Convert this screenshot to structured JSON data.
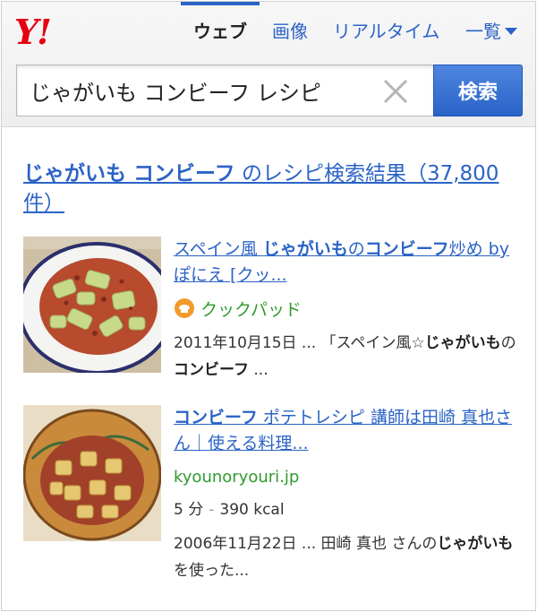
{
  "header": {
    "logo": "Y!",
    "tabs": [
      {
        "label": "ウェブ",
        "active": true
      },
      {
        "label": "画像",
        "active": false
      },
      {
        "label": "リアルタイム",
        "active": false
      },
      {
        "label": "一覧",
        "active": false
      }
    ],
    "search": {
      "value": "じゃがいも コンビーフ レシピ",
      "button_label": "検索"
    }
  },
  "results": {
    "heading": {
      "bold_part": "じゃがいも コンビーフ",
      "rest": " のレシピ検索結果（37,800件）"
    },
    "items": [
      {
        "title_parts": [
          {
            "text": "スペイン風 ",
            "bold": false
          },
          {
            "text": "じゃがいも",
            "bold": true
          },
          {
            "text": "の",
            "bold": false
          },
          {
            "text": "コンビーフ",
            "bold": true
          },
          {
            "text": "炒め by ぽにえ [クッ...",
            "bold": false
          }
        ],
        "source_name": "クックパッド",
        "snippet_parts": [
          {
            "text": "2011年10月15日 ... 「スペイン風☆",
            "bold": false
          },
          {
            "text": "じゃがいも",
            "bold": true
          },
          {
            "text": "の",
            "bold": false
          },
          {
            "text": "コンビーフ",
            "bold": true
          },
          {
            "text": " ...",
            "bold": false
          }
        ]
      },
      {
        "title_parts": [
          {
            "text": "コンビーフ",
            "bold": true
          },
          {
            "text": " ポテトレシピ 講師は田崎 真也さん｜使える料理...",
            "bold": false
          }
        ],
        "url": "kyounoryouri.jp",
        "meta_time": "5 分",
        "meta_sep": "-",
        "meta_kcal": "390 kcal",
        "snippet_parts": [
          {
            "text": "2006年11月22日 ... 田崎 真也 さんの",
            "bold": false
          },
          {
            "text": "じゃがいも",
            "bold": true
          },
          {
            "text": "を使った...",
            "bold": false
          }
        ]
      }
    ]
  },
  "colors": {
    "link": "#2b63c6",
    "green": "#2e9b2e",
    "logo": "#e60012"
  }
}
